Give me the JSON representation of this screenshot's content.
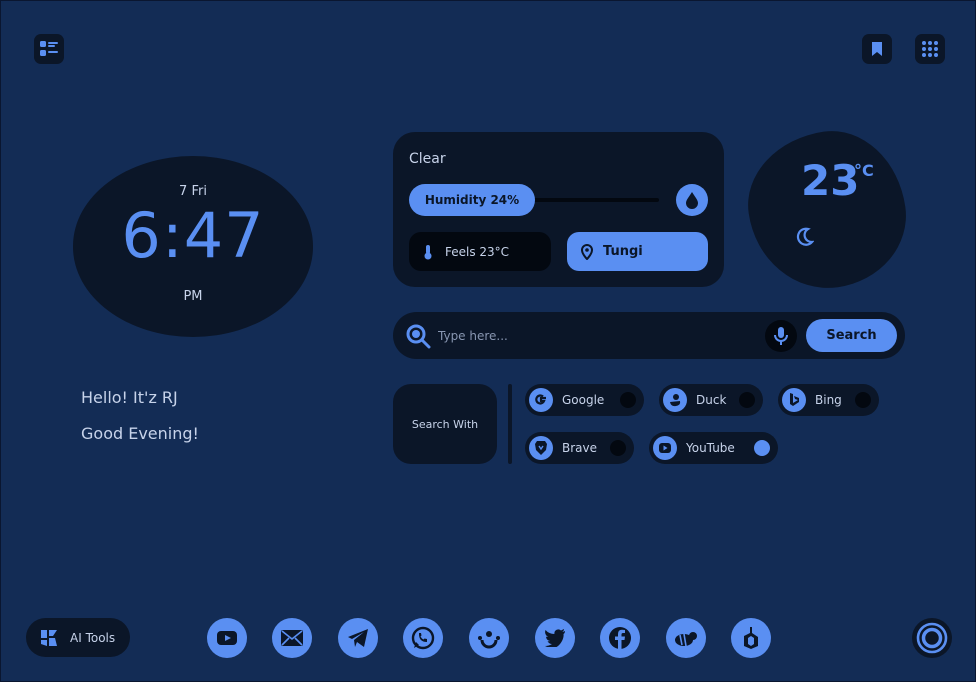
{
  "clock": {
    "date": "7 Fri",
    "time": "6:47",
    "ampm": "PM"
  },
  "greeting": {
    "line1": "Hello! It'z RJ",
    "line2": "Good Evening!"
  },
  "weather": {
    "condition": "Clear",
    "humidity_label": "Humidity 24%",
    "humidity_percent": 24,
    "feels_like": "Feels 23°C",
    "location": "Tungi",
    "temperature": "23",
    "unit": "°C"
  },
  "search": {
    "placeholder": "Type here...",
    "button_label": "Search",
    "search_with_label": "Search With"
  },
  "engines": [
    {
      "label": "Google",
      "icon": "google-icon",
      "selected": false
    },
    {
      "label": "Duck",
      "icon": "duck-icon",
      "selected": false
    },
    {
      "label": "Bing",
      "icon": "bing-icon",
      "selected": false
    },
    {
      "label": "Brave",
      "icon": "brave-icon",
      "selected": false
    },
    {
      "label": "YouTube",
      "icon": "youtube-icon",
      "selected": true
    }
  ],
  "ai_tools": {
    "label": "AI Tools"
  },
  "dock": [
    "youtube-icon",
    "mail-icon",
    "telegram-icon",
    "whatsapp-icon",
    "smile-icon",
    "twitter-icon",
    "facebook-icon",
    "bee-icon",
    "bolt-icon"
  ],
  "colors": {
    "background": "#132c55",
    "card": "#0b1628",
    "accent": "#5a8ff2",
    "text": "#c7d3ea"
  }
}
